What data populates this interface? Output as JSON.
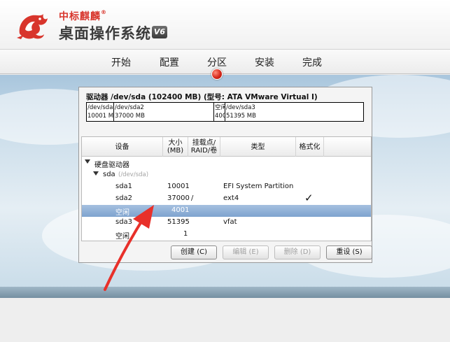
{
  "brand": {
    "company": "中标麒麟",
    "registered": "®",
    "product": "桌面操作系统",
    "version": "V6"
  },
  "steps": [
    {
      "label": "开始"
    },
    {
      "label": "配置"
    },
    {
      "label": "分区"
    },
    {
      "label": "安装"
    },
    {
      "label": "完成"
    }
  ],
  "active_step": "分区",
  "drive": {
    "title": "驱动器 /dev/sda (102400 MB) (型号: ATA VMware Virtual I)",
    "segments": [
      {
        "name": "/dev/sda",
        "size": "10001 M"
      },
      {
        "name": "/dev/sda2",
        "size": "37000 MB"
      },
      {
        "name": "空闲",
        "size": "400"
      },
      {
        "name": "/dev/sda3",
        "size": "51395 MB"
      }
    ]
  },
  "table": {
    "headers": {
      "device": "设备",
      "size": "大小\n(MB)",
      "mount": "挂载点/\nRAID/卷",
      "type": "类型",
      "format": "格式化"
    },
    "group_label": "硬盘驱动器",
    "disk_label": "sda",
    "disk_path": "(/dev/sda)",
    "rows": [
      {
        "device": "sda1",
        "size": "10001",
        "mount": "",
        "type": "EFI System Partition",
        "format": ""
      },
      {
        "device": "sda2",
        "size": "37000",
        "mount": "/",
        "type": "ext4",
        "format": "✓"
      },
      {
        "device": "空闲",
        "size": "4001",
        "mount": "",
        "type": "",
        "format": ""
      },
      {
        "device": "sda3",
        "size": "51395",
        "mount": "",
        "type": "vfat",
        "format": ""
      },
      {
        "device": "空闲",
        "size": "1",
        "mount": "",
        "type": "",
        "format": ""
      }
    ],
    "selected_row": 2
  },
  "buttons": {
    "create": "创建 (C)",
    "edit": "编辑 (E)",
    "delete": "删除 (D)",
    "reset": "重设 (S)"
  },
  "colors": {
    "accent": "#d8352c",
    "selection": "#7ea3cf",
    "annotation_arrow": "#e8302a"
  }
}
